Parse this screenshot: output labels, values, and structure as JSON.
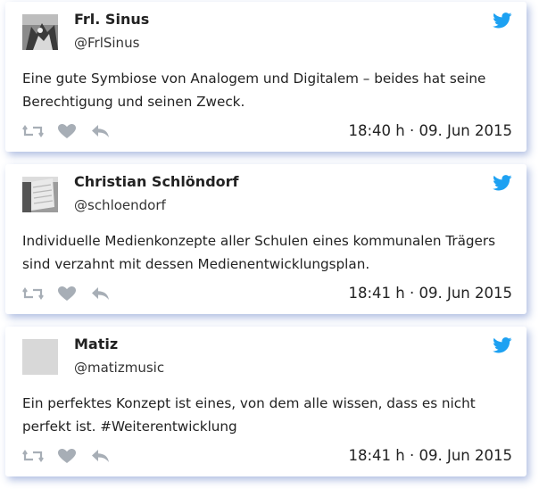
{
  "tweets": [
    {
      "name": "Frl. Sinus",
      "handle": "@FrlSinus",
      "text": "Eine gute Symbiose von Analogem und Digitalem – beides hat seine Berechtigung und seinen Zweck.",
      "timestamp": "18:40 h · 09. Jun 2015",
      "icons": [
        "retweet-icon",
        "heart-icon",
        "reply-icon",
        "twitter-bird-icon"
      ]
    },
    {
      "name": "Christian Schlöndorf",
      "handle": "@schloendorf",
      "text": "Individuelle Medienkonzepte aller Schulen eines kommunalen Trägers sind verzahnt mit dessen Medienentwicklungsplan.",
      "timestamp": "18:41 h · 09. Jun 2015",
      "icons": [
        "retweet-icon",
        "heart-icon",
        "reply-icon",
        "twitter-bird-icon"
      ]
    },
    {
      "name": "Matiz",
      "handle": "@matizmusic",
      "text": "Ein perfektes Konzept ist eines, von dem alle wissen, dass es nicht perfekt ist. #Weiterentwicklung",
      "timestamp": "18:41 h · 09. Jun 2015",
      "icons": [
        "retweet-icon",
        "heart-icon",
        "reply-icon",
        "twitter-bird-icon"
      ]
    }
  ],
  "colors": {
    "twitter_blue": "#1da1f2",
    "action_gray": "#a7aeb6",
    "card_shadow": "#506ebe"
  }
}
